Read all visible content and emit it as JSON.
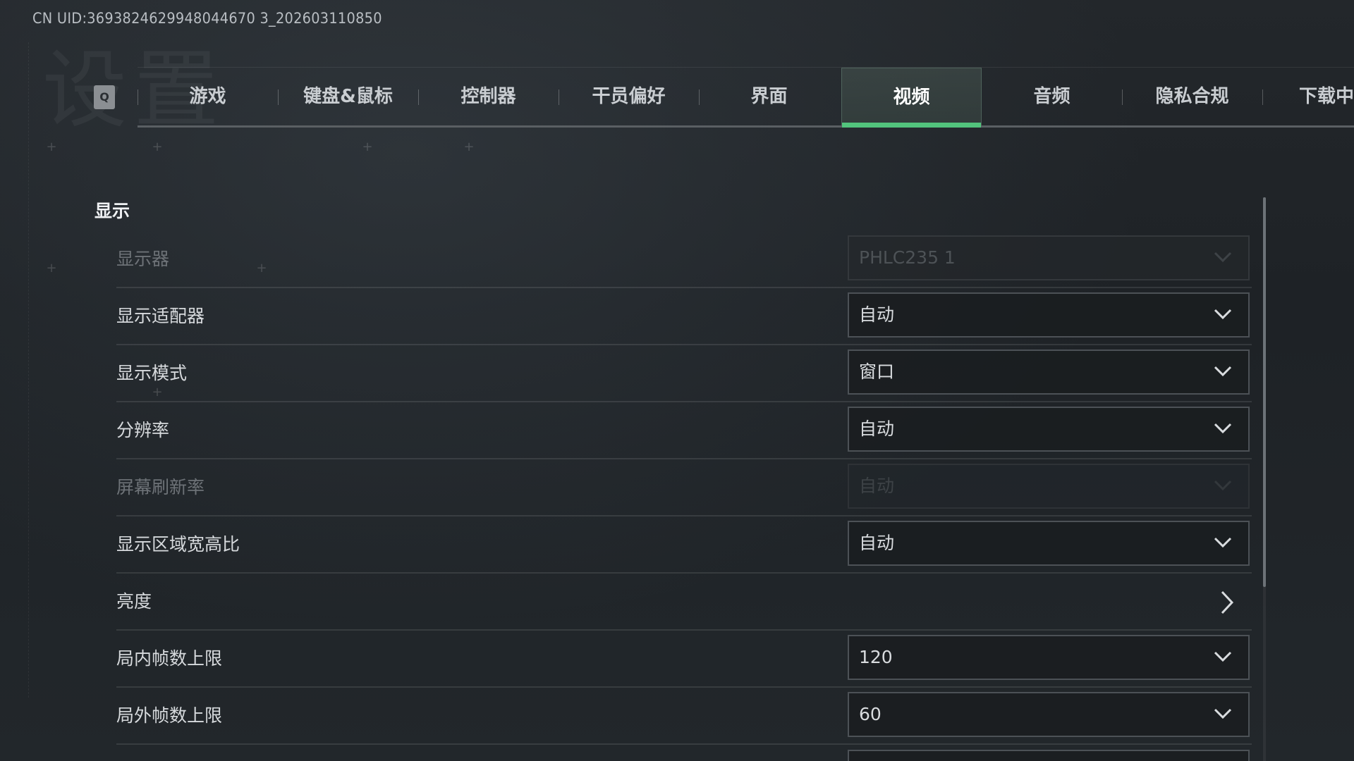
{
  "header": {
    "uid_text": "CN UID:3693824629948044670 3_202603110850"
  },
  "tabs": {
    "key_hint": "Q",
    "items": [
      {
        "label": "游戏"
      },
      {
        "label": "键盘&鼠标"
      },
      {
        "label": "控制器"
      },
      {
        "label": "干员偏好"
      },
      {
        "label": "界面"
      },
      {
        "label": "视频",
        "active": true
      },
      {
        "label": "音频"
      },
      {
        "label": "隐私合规"
      },
      {
        "label": "下载中"
      }
    ]
  },
  "section": {
    "title": "显示"
  },
  "settings": [
    {
      "label": "显示器",
      "value": "PHLC235 1",
      "type": "dropdown",
      "disabled": true
    },
    {
      "label": "显示适配器",
      "value": "自动",
      "type": "dropdown"
    },
    {
      "label": "显示模式",
      "value": "窗口",
      "type": "dropdown"
    },
    {
      "label": "分辨率",
      "value": "自动",
      "type": "dropdown"
    },
    {
      "label": "屏幕刷新率",
      "value": "自动",
      "type": "dropdown",
      "disabled": true
    },
    {
      "label": "显示区域宽高比",
      "value": "自动",
      "type": "dropdown"
    },
    {
      "label": "亮度",
      "type": "link"
    },
    {
      "label": "局内帧数上限",
      "value": "120",
      "type": "dropdown"
    },
    {
      "label": "局外帧数上限",
      "value": "60",
      "type": "dropdown"
    }
  ],
  "colors": {
    "accent": "#52c47d",
    "background": "#1f2327",
    "text": "#d9dcdf"
  },
  "icons": {
    "dropdown": "chevron-down-icon",
    "link": "chevron-right-icon"
  }
}
